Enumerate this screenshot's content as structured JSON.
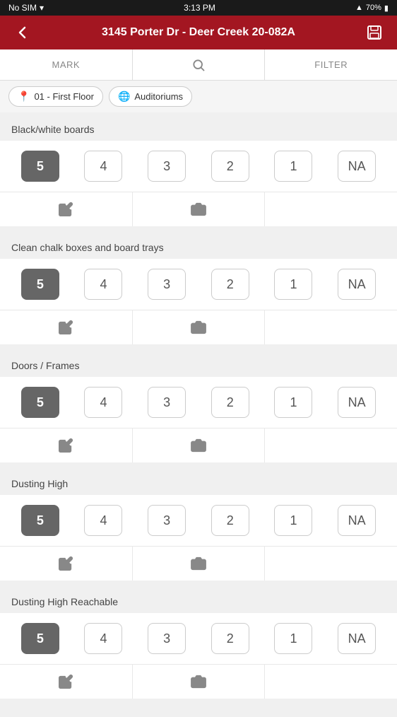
{
  "statusBar": {
    "carrier": "No SIM",
    "time": "3:13 PM",
    "signal": "▲",
    "battery": "70%"
  },
  "header": {
    "backLabel": "‹",
    "title": "3145 Porter Dr - Deer Creek 20-082A",
    "saveIcon": "save"
  },
  "toolbar": {
    "markLabel": "MARK",
    "filterLabel": "FILTER"
  },
  "filterPills": [
    {
      "icon": "📍",
      "label": "01 - First Floor"
    },
    {
      "icon": "🌐",
      "label": "Auditoriums"
    }
  ],
  "sections": [
    {
      "title": "Black/white boards",
      "ratings": [
        "5",
        "4",
        "3",
        "2",
        "1",
        "NA"
      ],
      "selectedIndex": 0
    },
    {
      "title": "Clean chalk boxes and board trays",
      "ratings": [
        "5",
        "4",
        "3",
        "2",
        "1",
        "NA"
      ],
      "selectedIndex": 0
    },
    {
      "title": "Doors / Frames",
      "ratings": [
        "5",
        "4",
        "3",
        "2",
        "1",
        "NA"
      ],
      "selectedIndex": 0
    },
    {
      "title": "Dusting High",
      "ratings": [
        "5",
        "4",
        "3",
        "2",
        "1",
        "NA"
      ],
      "selectedIndex": 0
    },
    {
      "title": "Dusting High Reachable",
      "ratings": [
        "5",
        "4",
        "3",
        "2",
        "1",
        "NA"
      ],
      "selectedIndex": 0
    }
  ]
}
